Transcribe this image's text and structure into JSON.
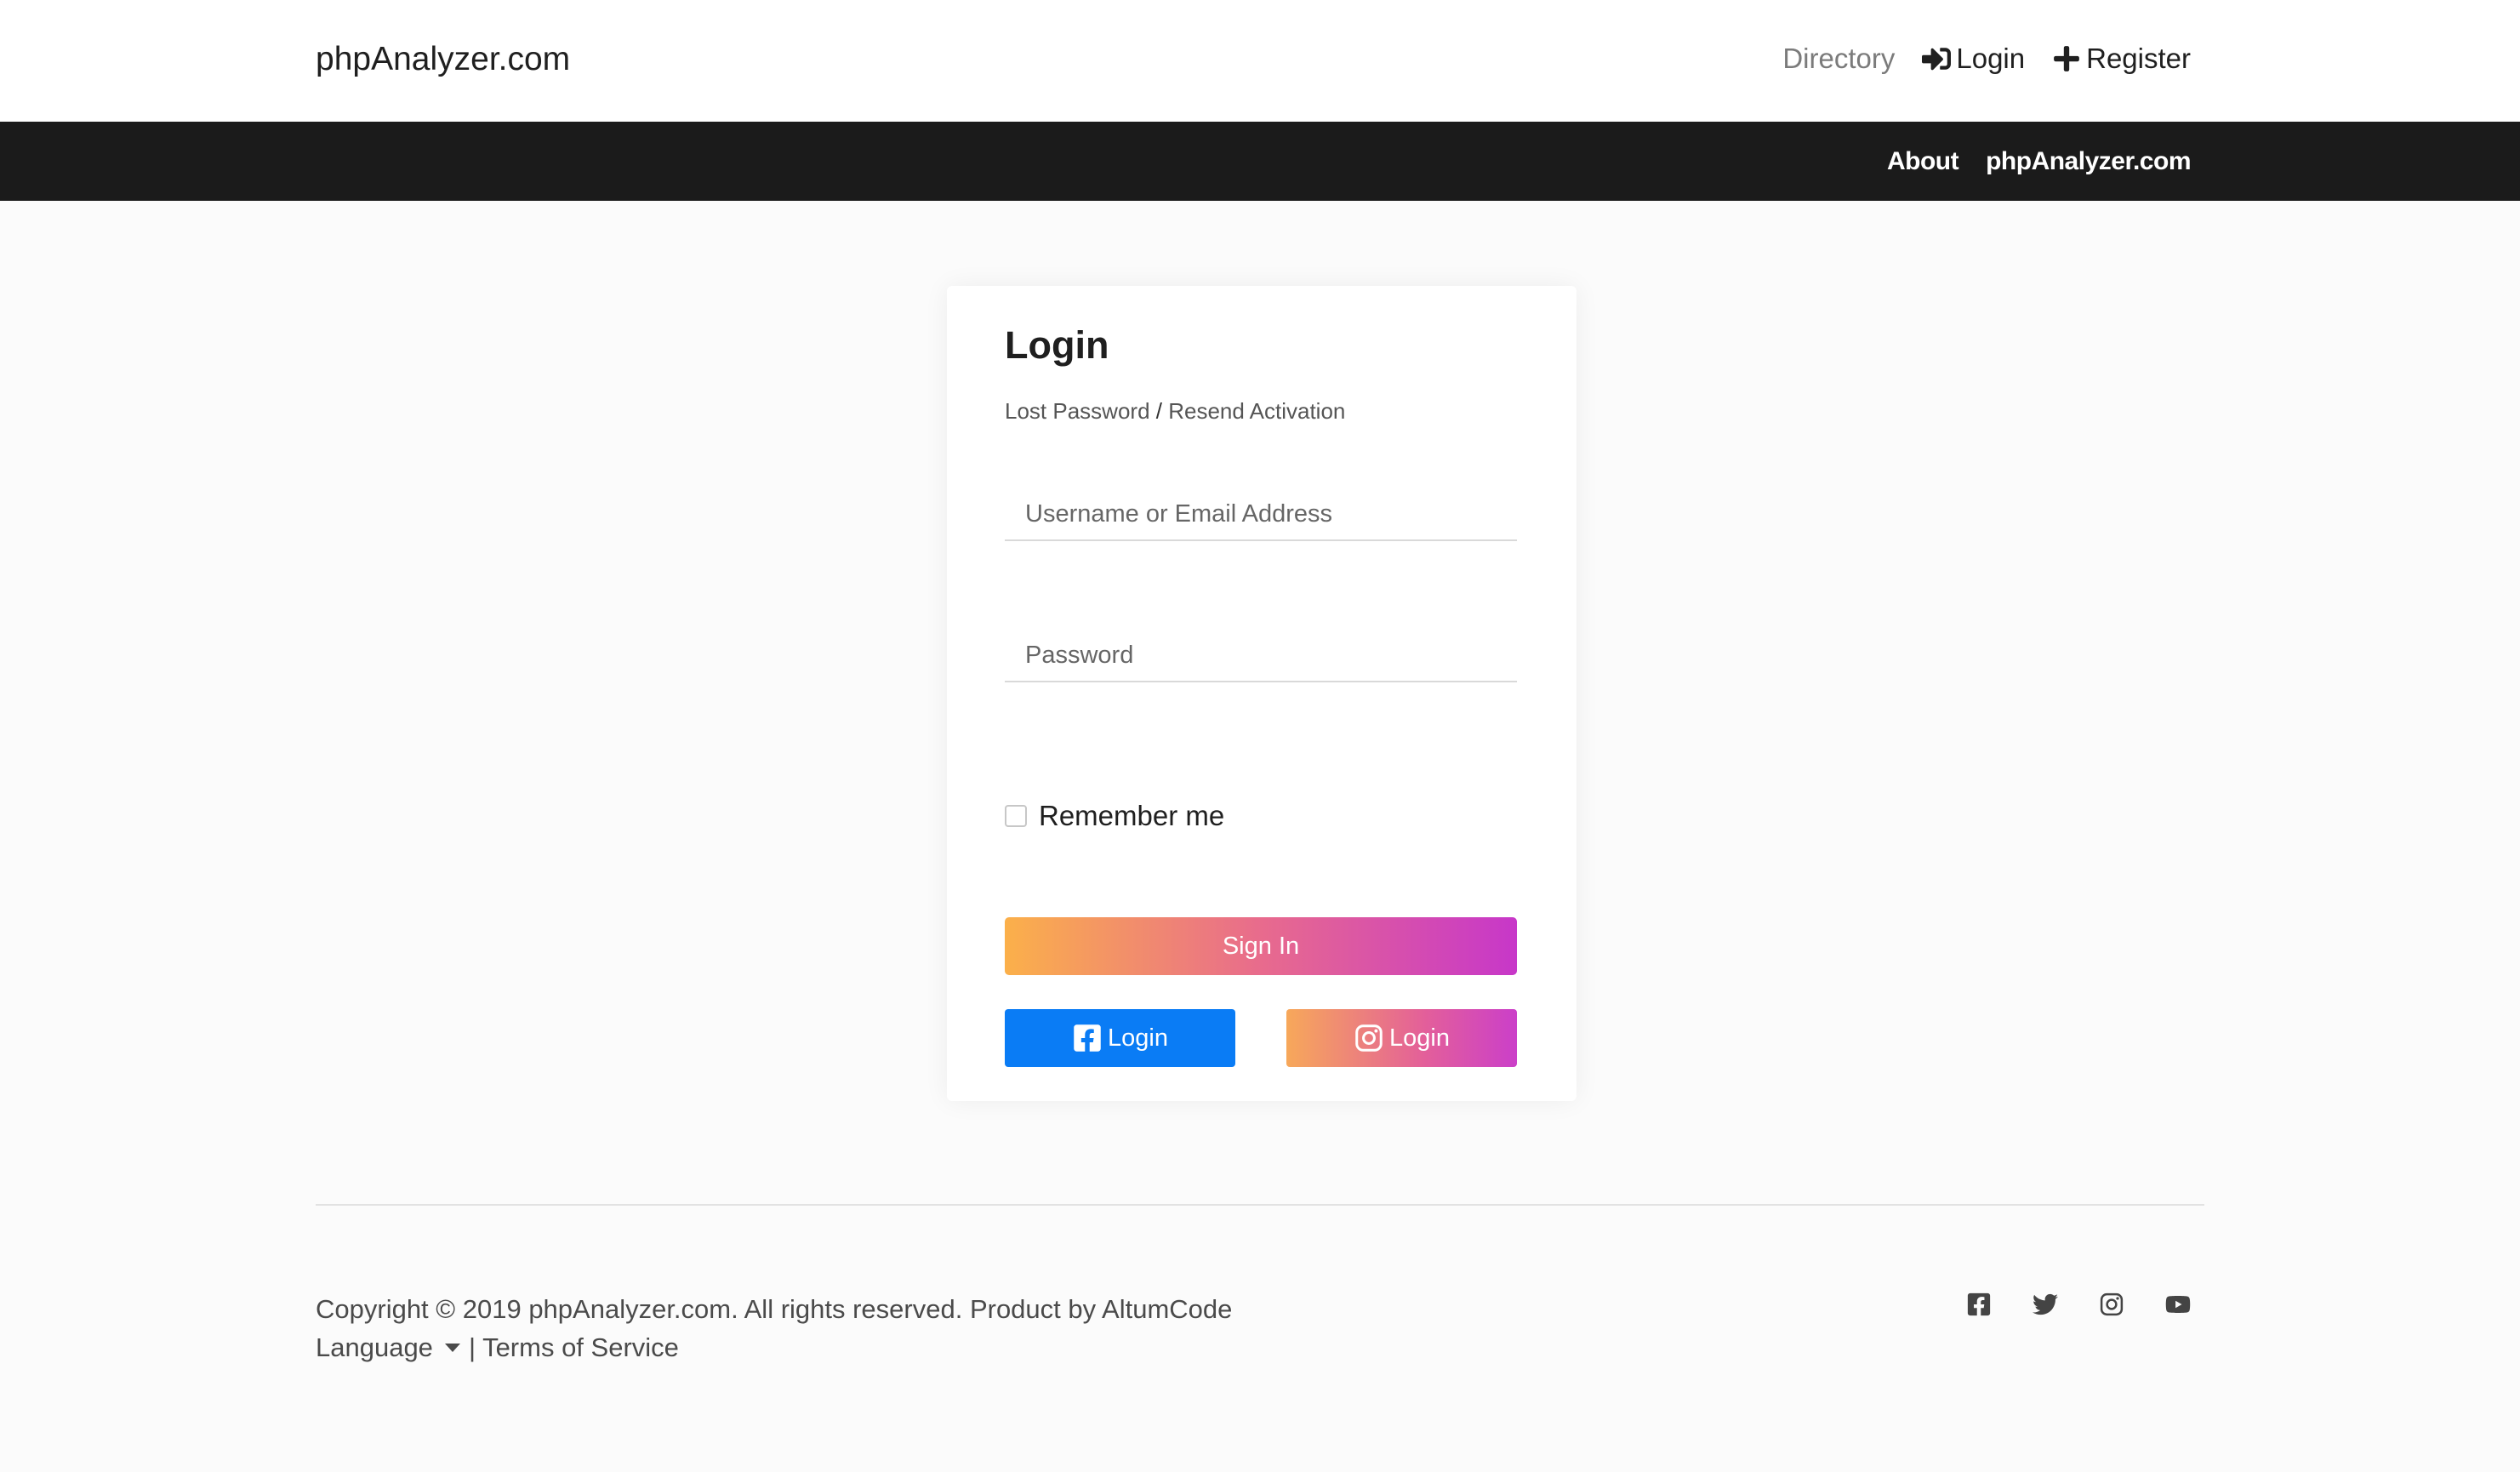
{
  "header": {
    "brand": "phpAnalyzer.com",
    "nav": {
      "directory": "Directory",
      "login": "Login",
      "register": "Register"
    }
  },
  "subnav": {
    "about": "About",
    "site": "phpAnalyzer.com"
  },
  "login_card": {
    "title": "Login",
    "lost_password": "Lost Password",
    "separator": "/",
    "resend_activation": "Resend Activation",
    "username_placeholder": "Username or Email Address",
    "password_placeholder": "Password",
    "remember_label": "Remember me",
    "signin_label": "Sign In",
    "facebook_label": "Login",
    "instagram_label": "Login"
  },
  "footer": {
    "copyright": "Copyright © 2019 phpAnalyzer.com. All rights reserved. Product by AltumCode",
    "language": "Language",
    "separator": "|",
    "terms": "Terms of Service",
    "social_icons": [
      "facebook-icon",
      "twitter-icon",
      "instagram-icon",
      "youtube-icon"
    ]
  },
  "colors": {
    "dark_bar": "#1b1b1b",
    "facebook_blue": "#0a7cf5",
    "gradient_start": "#fbb04a",
    "gradient_end": "#c737c9"
  }
}
